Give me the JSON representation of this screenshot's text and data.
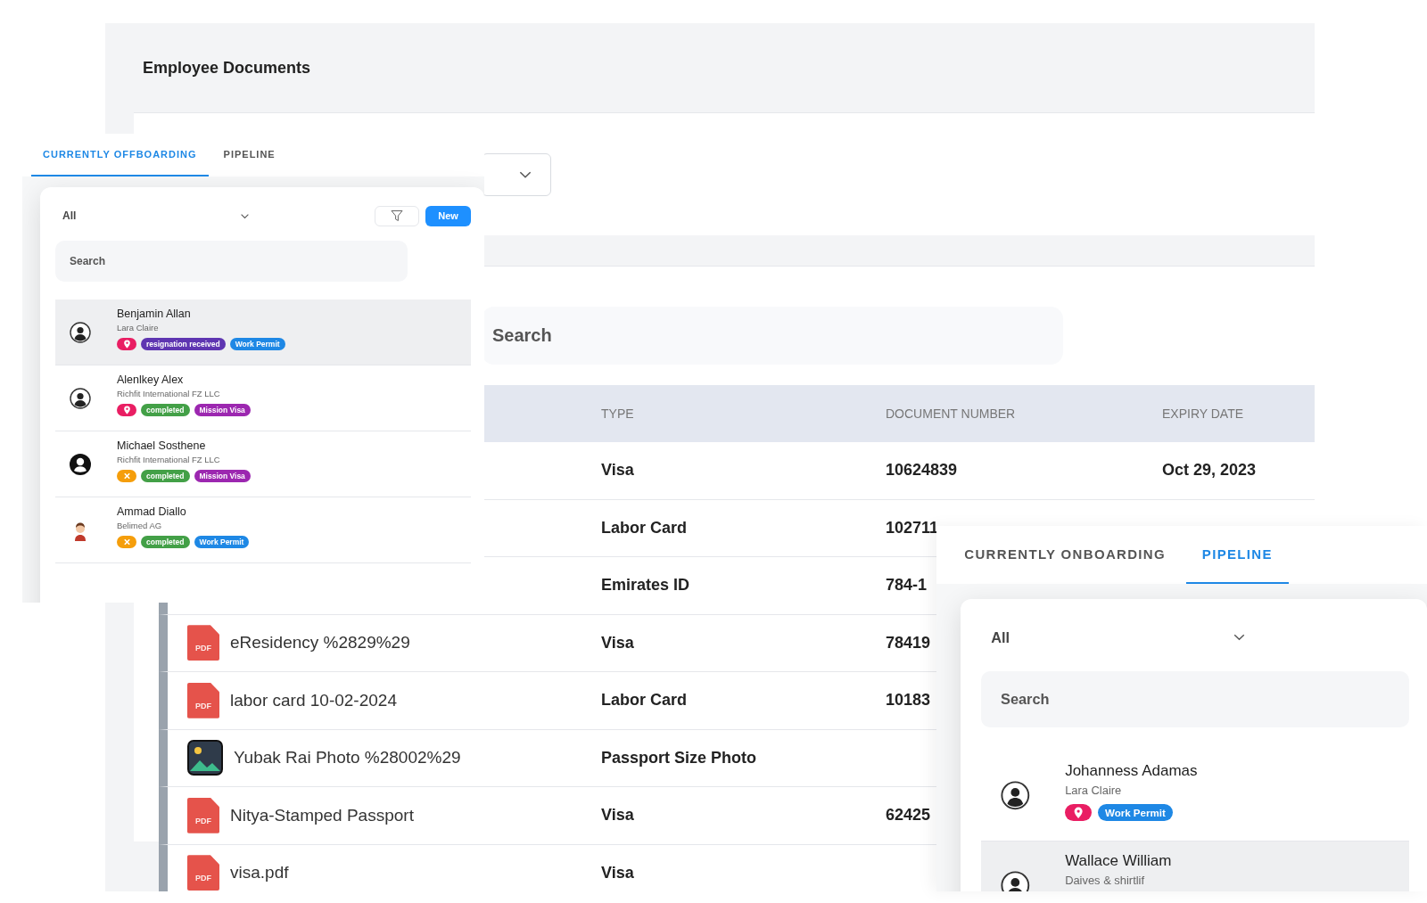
{
  "window": {
    "title": "Employee Documents"
  },
  "search": {
    "placeholder": "Search"
  },
  "table": {
    "columns": [
      "TYPE",
      "DOCUMENT NUMBER",
      "EXPIRY DATE"
    ],
    "rows": [
      {
        "type": "Visa",
        "document_number": "10624839",
        "expiry_date": "Oct 29, 2023"
      },
      {
        "type": "Labor Card",
        "document_number": "102711"
      },
      {
        "type": "Emirates ID",
        "document_number": "784-1"
      },
      {
        "file_icon": {
          "kind": "pdf",
          "badge": "PDF"
        },
        "name": "eResidency %2829%29",
        "type": "Visa",
        "document_number": "78419"
      },
      {
        "file_icon": {
          "kind": "pdf",
          "badge": "PDF"
        },
        "name": "labor card 10-02-2024",
        "type": "Labor Card",
        "document_number": "10183"
      },
      {
        "file_icon": {
          "kind": "image"
        },
        "name": "Yubak Rai Photo %28002%29",
        "type": "Passport Size Photo"
      },
      {
        "file_icon": {
          "kind": "pdf",
          "badge": "PDF"
        },
        "name": "Nitya-Stamped Passport",
        "type": "Visa",
        "document_number": "62425"
      },
      {
        "file_icon": {
          "kind": "pdf",
          "badge": "PDF"
        },
        "name": "visa.pdf",
        "type": "Visa"
      }
    ]
  },
  "panels": [
    {
      "tabs": [
        {
          "label": "CURRENTLY OFFBOARDING",
          "selected": true
        },
        {
          "label": "PIPELINE",
          "selected": false
        }
      ],
      "filter": {
        "value": "All"
      },
      "filter_button": true,
      "new_button": "New",
      "search": {
        "placeholder": "Search"
      },
      "people": [
        {
          "name": "Benjamin Allan",
          "subtitle": "Lara Claire",
          "avatar": {
            "kind": "outline"
          },
          "selected": true,
          "tags": [
            {
              "kind": "pin",
              "color": "#e91e63"
            },
            {
              "kind": "label",
              "text": "resignation received",
              "color": "#5e35b1"
            },
            {
              "kind": "label",
              "text": "Work Permit",
              "color": "#1e88e5"
            }
          ]
        },
        {
          "name": "Alenlkey Alex",
          "subtitle": "Richfit International FZ LLC",
          "avatar": {
            "kind": "outline"
          },
          "selected": false,
          "tags": [
            {
              "kind": "pin",
              "color": "#e91e63"
            },
            {
              "kind": "label",
              "text": "completed",
              "color": "#43a047"
            },
            {
              "kind": "label",
              "text": "Mission Visa",
              "color": "#9c27b0"
            }
          ]
        },
        {
          "name": "Michael Sosthene",
          "subtitle": "Richfit International FZ LLC",
          "avatar": {
            "kind": "solid"
          },
          "selected": false,
          "tags": [
            {
              "kind": "cross",
              "color": "#f59e0b"
            },
            {
              "kind": "label",
              "text": "completed",
              "color": "#43a047"
            },
            {
              "kind": "label",
              "text": "Mission Visa",
              "color": "#9c27b0"
            }
          ]
        },
        {
          "name": "Ammad Diallo",
          "subtitle": "Belimed AG",
          "avatar": {
            "kind": "figure"
          },
          "selected": false,
          "tags": [
            {
              "kind": "cross",
              "color": "#f59e0b"
            },
            {
              "kind": "label",
              "text": "completed",
              "color": "#43a047"
            },
            {
              "kind": "label",
              "text": "Work Permit",
              "color": "#1e88e5"
            }
          ]
        }
      ]
    },
    {
      "tabs": [
        {
          "label": "CURRENTLY ONBOARDING",
          "selected": false
        },
        {
          "label": "PIPELINE",
          "selected": true
        }
      ],
      "filter": {
        "value": "All"
      },
      "search": {
        "placeholder": "Search"
      },
      "people": [
        {
          "name": "Johanness Adamas",
          "subtitle": "Lara Claire",
          "avatar": {
            "kind": "outline"
          },
          "selected": false,
          "tags": [
            {
              "kind": "pin",
              "color": "#e91e63"
            },
            {
              "kind": "label",
              "text": "Work Permit",
              "color": "#1e88e5"
            }
          ]
        },
        {
          "name": "Wallace William",
          "subtitle": "Daives & shirtlif",
          "avatar": {
            "kind": "outline"
          },
          "selected": true
        }
      ]
    }
  ]
}
